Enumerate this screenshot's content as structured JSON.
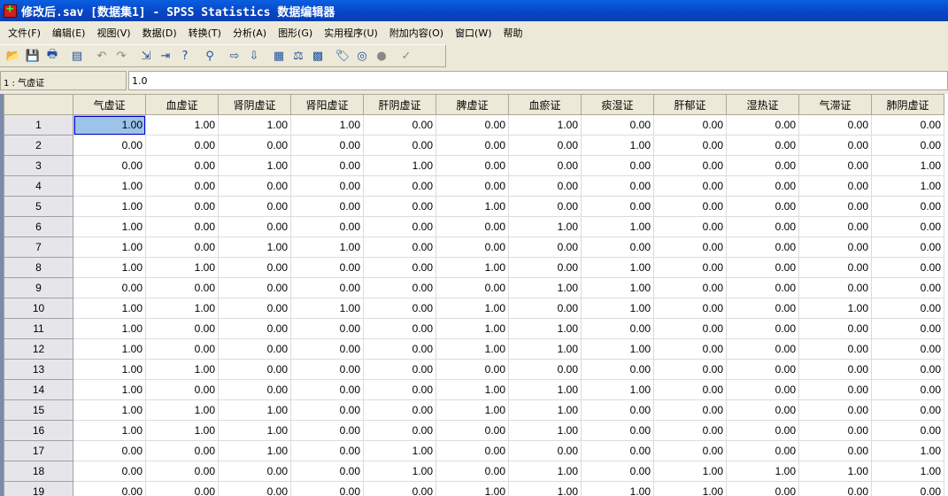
{
  "window": {
    "title": "修改后.sav [数据集1] - SPSS Statistics 数据编辑器"
  },
  "menu": [
    "文件(F)",
    "编辑(E)",
    "视图(V)",
    "数据(D)",
    "转换(T)",
    "分析(A)",
    "图形(G)",
    "实用程序(U)",
    "附加内容(O)",
    "窗口(W)",
    "帮助"
  ],
  "toolbar": [
    "open-icon",
    "save-icon",
    "print-icon",
    "dialog-recall-icon",
    "undo-icon",
    "redo-icon",
    "goto-case-icon",
    "goto-variable-icon",
    "variables-icon",
    "find-icon",
    "insert-cases-icon",
    "insert-variable-icon",
    "split-file-icon",
    "weight-cases-icon",
    "select-cases-icon",
    "value-labels-icon",
    "use-sets-icon",
    "show-all-variables-icon",
    "spell-check-icon"
  ],
  "editor": {
    "cell_ref": "1 : 气虚证",
    "cell_value": "1.0"
  },
  "table": {
    "columns": [
      "气虚证",
      "血虚证",
      "肾阴虚证",
      "肾阳虚证",
      "肝阴虚证",
      "脾虚证",
      "血瘀证",
      "痰湿证",
      "肝郁证",
      "湿热证",
      "气滞证",
      "肺阴虚证"
    ],
    "rows": [
      [
        "1",
        [
          "1.00",
          "1.00",
          "1.00",
          "1.00",
          "0.00",
          "0.00",
          "1.00",
          "0.00",
          "0.00",
          "0.00",
          "0.00",
          "0.00"
        ]
      ],
      [
        "2",
        [
          "0.00",
          "0.00",
          "0.00",
          "0.00",
          "0.00",
          "0.00",
          "0.00",
          "1.00",
          "0.00",
          "0.00",
          "0.00",
          "0.00"
        ]
      ],
      [
        "3",
        [
          "0.00",
          "0.00",
          "1.00",
          "0.00",
          "1.00",
          "0.00",
          "0.00",
          "0.00",
          "0.00",
          "0.00",
          "0.00",
          "1.00"
        ]
      ],
      [
        "4",
        [
          "1.00",
          "0.00",
          "0.00",
          "0.00",
          "0.00",
          "0.00",
          "0.00",
          "0.00",
          "0.00",
          "0.00",
          "0.00",
          "1.00"
        ]
      ],
      [
        "5",
        [
          "1.00",
          "0.00",
          "0.00",
          "0.00",
          "0.00",
          "1.00",
          "0.00",
          "0.00",
          "0.00",
          "0.00",
          "0.00",
          "0.00"
        ]
      ],
      [
        "6",
        [
          "1.00",
          "0.00",
          "0.00",
          "0.00",
          "0.00",
          "0.00",
          "1.00",
          "1.00",
          "0.00",
          "0.00",
          "0.00",
          "0.00"
        ]
      ],
      [
        "7",
        [
          "1.00",
          "0.00",
          "1.00",
          "1.00",
          "0.00",
          "0.00",
          "0.00",
          "0.00",
          "0.00",
          "0.00",
          "0.00",
          "0.00"
        ]
      ],
      [
        "8",
        [
          "1.00",
          "1.00",
          "0.00",
          "0.00",
          "0.00",
          "1.00",
          "0.00",
          "1.00",
          "0.00",
          "0.00",
          "0.00",
          "0.00"
        ]
      ],
      [
        "9",
        [
          "0.00",
          "0.00",
          "0.00",
          "0.00",
          "0.00",
          "0.00",
          "1.00",
          "1.00",
          "0.00",
          "0.00",
          "0.00",
          "0.00"
        ]
      ],
      [
        "10",
        [
          "1.00",
          "1.00",
          "0.00",
          "1.00",
          "0.00",
          "1.00",
          "0.00",
          "1.00",
          "0.00",
          "0.00",
          "1.00",
          "0.00"
        ]
      ],
      [
        "11",
        [
          "1.00",
          "0.00",
          "0.00",
          "0.00",
          "0.00",
          "1.00",
          "1.00",
          "0.00",
          "0.00",
          "0.00",
          "0.00",
          "0.00"
        ]
      ],
      [
        "12",
        [
          "1.00",
          "0.00",
          "0.00",
          "0.00",
          "0.00",
          "1.00",
          "1.00",
          "1.00",
          "0.00",
          "0.00",
          "0.00",
          "0.00"
        ]
      ],
      [
        "13",
        [
          "1.00",
          "1.00",
          "0.00",
          "0.00",
          "0.00",
          "0.00",
          "0.00",
          "0.00",
          "0.00",
          "0.00",
          "0.00",
          "0.00"
        ]
      ],
      [
        "14",
        [
          "1.00",
          "0.00",
          "0.00",
          "0.00",
          "0.00",
          "1.00",
          "1.00",
          "1.00",
          "0.00",
          "0.00",
          "0.00",
          "0.00"
        ]
      ],
      [
        "15",
        [
          "1.00",
          "1.00",
          "1.00",
          "0.00",
          "0.00",
          "1.00",
          "1.00",
          "0.00",
          "0.00",
          "0.00",
          "0.00",
          "0.00"
        ]
      ],
      [
        "16",
        [
          "1.00",
          "1.00",
          "1.00",
          "0.00",
          "0.00",
          "0.00",
          "1.00",
          "0.00",
          "0.00",
          "0.00",
          "0.00",
          "0.00"
        ]
      ],
      [
        "17",
        [
          "0.00",
          "0.00",
          "1.00",
          "0.00",
          "1.00",
          "0.00",
          "0.00",
          "0.00",
          "0.00",
          "0.00",
          "0.00",
          "1.00"
        ]
      ],
      [
        "18",
        [
          "0.00",
          "0.00",
          "0.00",
          "0.00",
          "1.00",
          "0.00",
          "1.00",
          "0.00",
          "1.00",
          "1.00",
          "1.00",
          "1.00"
        ]
      ],
      [
        "19",
        [
          "0.00",
          "0.00",
          "0.00",
          "0.00",
          "0.00",
          "1.00",
          "1.00",
          "1.00",
          "1.00",
          "0.00",
          "0.00",
          "0.00"
        ]
      ]
    ]
  }
}
